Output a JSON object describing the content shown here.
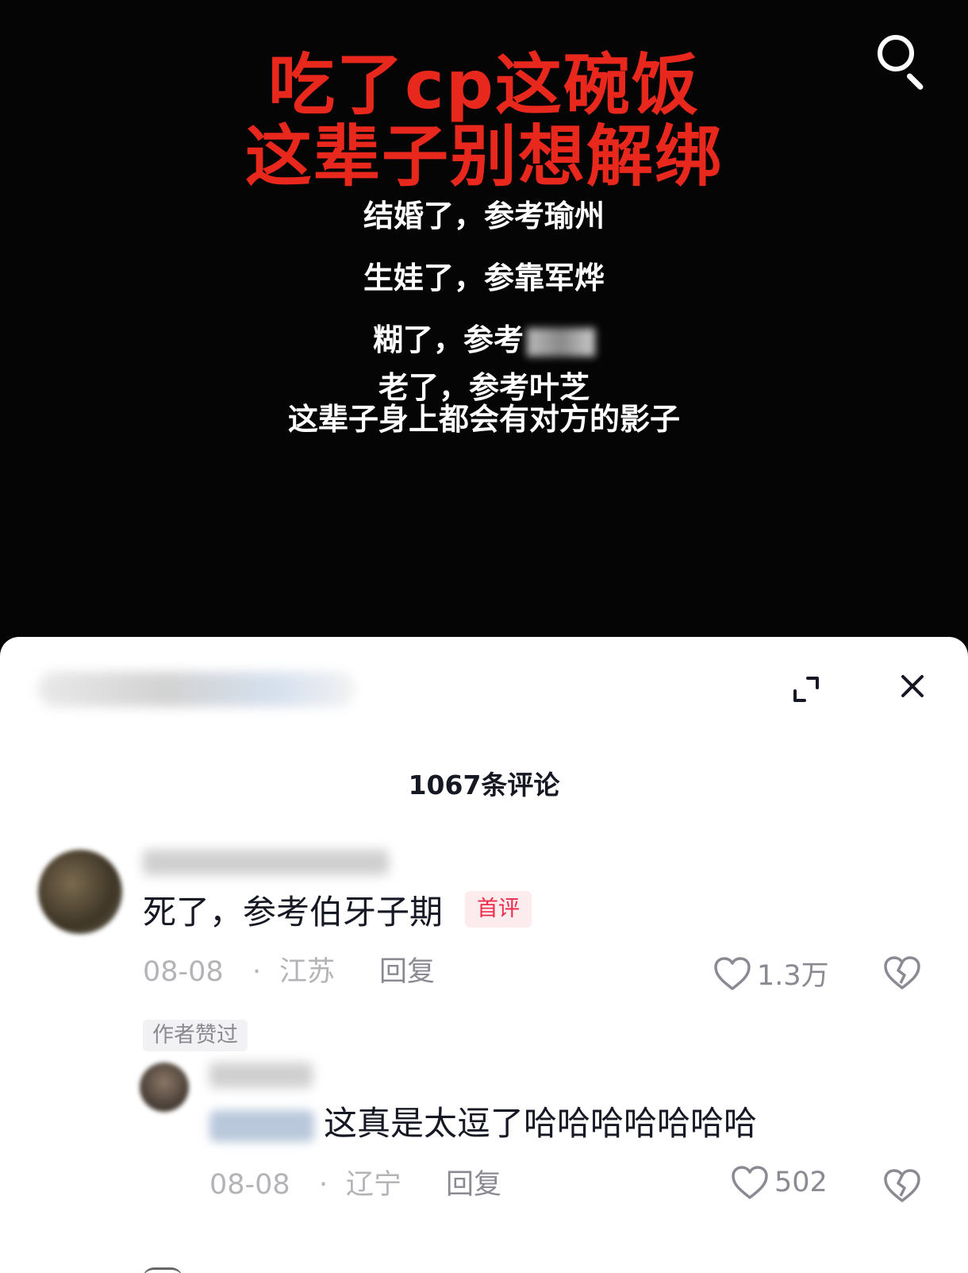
{
  "video": {
    "title_line1": "吃了cp这碗饭",
    "title_line2": "这辈子别想解绑",
    "lines": [
      "结婚了，参考瑜州",
      "生娃了，参靠军烨",
      "糊了，参考",
      "老了，参考叶芝",
      "这辈子身上都会有对方的影子"
    ],
    "title_color": "#e8271d"
  },
  "sheet": {
    "comment_count": "1067条评论"
  },
  "comments": [
    {
      "text": "死了，参考伯牙子期",
      "badge": "首评",
      "date": "08-08",
      "separator": "·",
      "location": "江苏",
      "reply_label": "回复",
      "likes": "1.3万",
      "author_liked": "作者赞过"
    },
    {
      "text": "这真是太逗了哈哈哈哈哈哈哈",
      "date": "08-08",
      "separator": "·",
      "location": "辽宁",
      "reply_label": "回复",
      "likes": "502"
    }
  ],
  "icons": {
    "search": "search-icon",
    "expand": "expand-icon",
    "close": "close-icon",
    "like": "heart-icon",
    "dislike": "broken-heart-icon"
  }
}
